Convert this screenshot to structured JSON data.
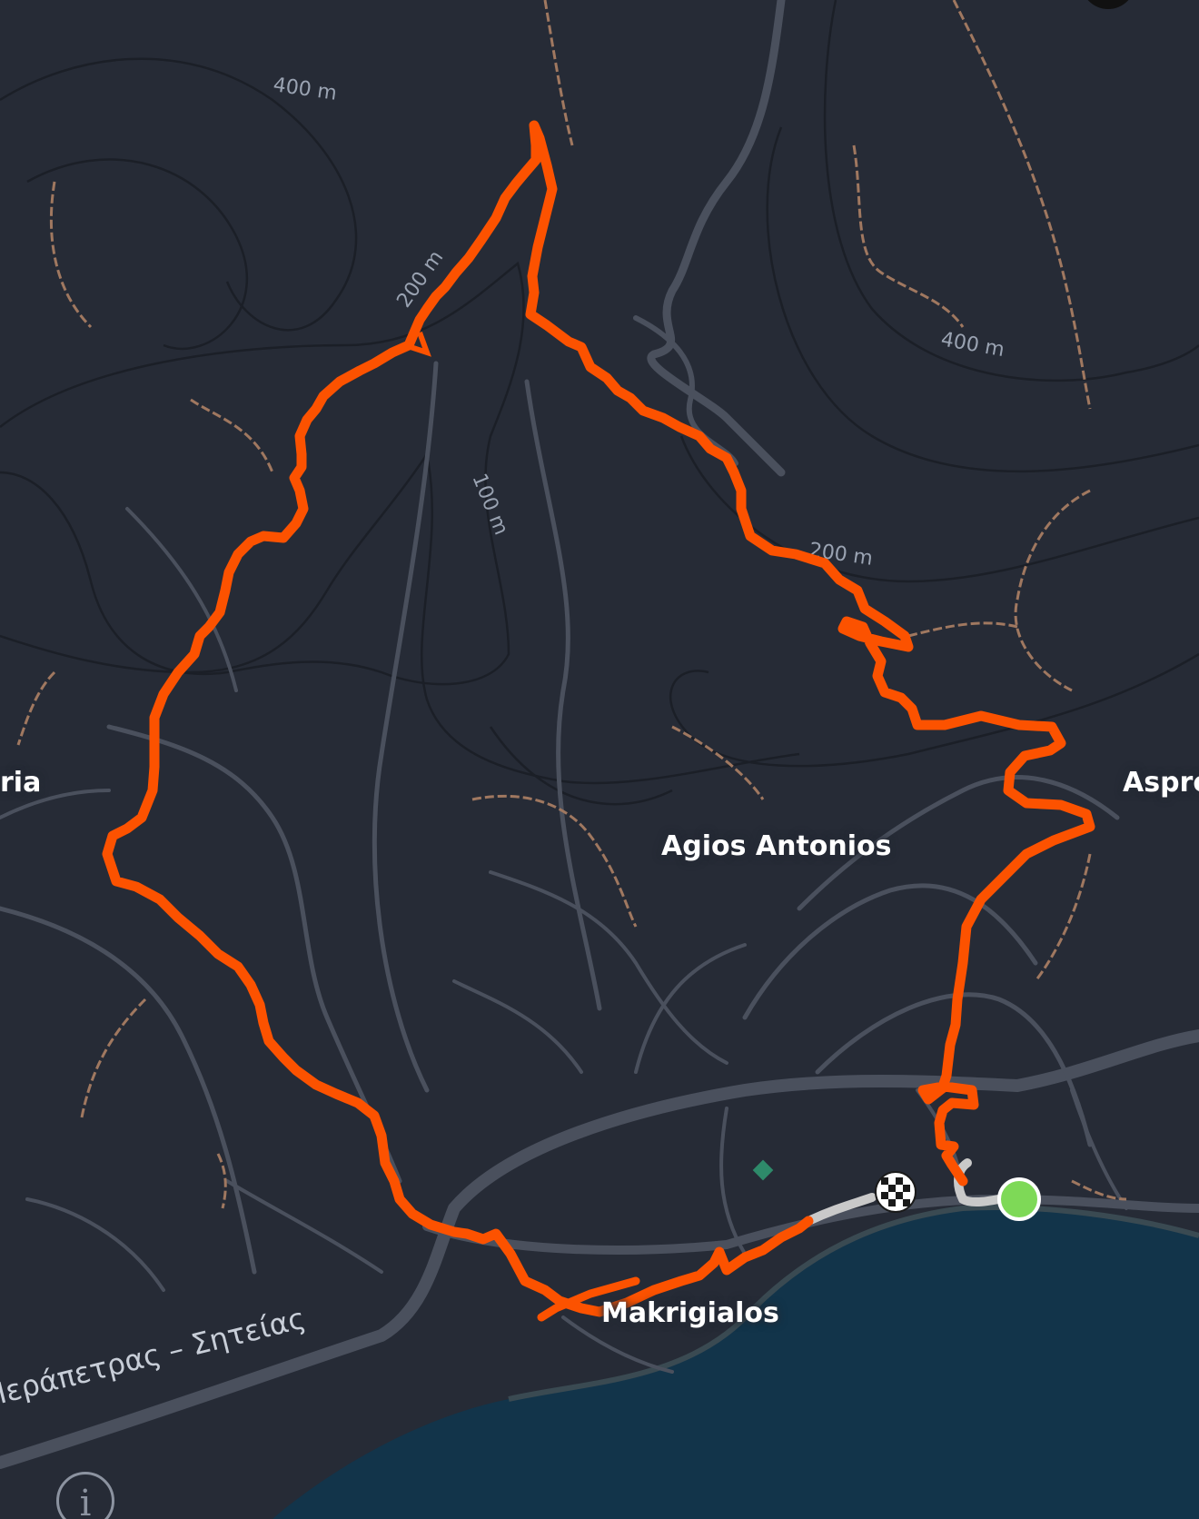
{
  "places": {
    "agios_antonios": "Agios Antonios",
    "makrigialos": "Makrigialos",
    "left_edge": "ria",
    "right_edge": "Aspro"
  },
  "contours": {
    "c400_top_left": "400 m",
    "c200_left": "200 m",
    "c100_center": "100 m",
    "c400_top_right": "400 m",
    "c200_right": "200 m"
  },
  "road": {
    "name": "Ιεράπετρας – Σητείας"
  },
  "info_icon": "info-icon",
  "start_marker_icon": "start-dot-icon",
  "finish_marker_icon": "checkered-flag-icon",
  "colors": {
    "background": "#262b36",
    "sea": "#12344a",
    "route": "#fc5200",
    "start": "#7ed957",
    "trail": "#a07860",
    "road": "#4a505d"
  }
}
